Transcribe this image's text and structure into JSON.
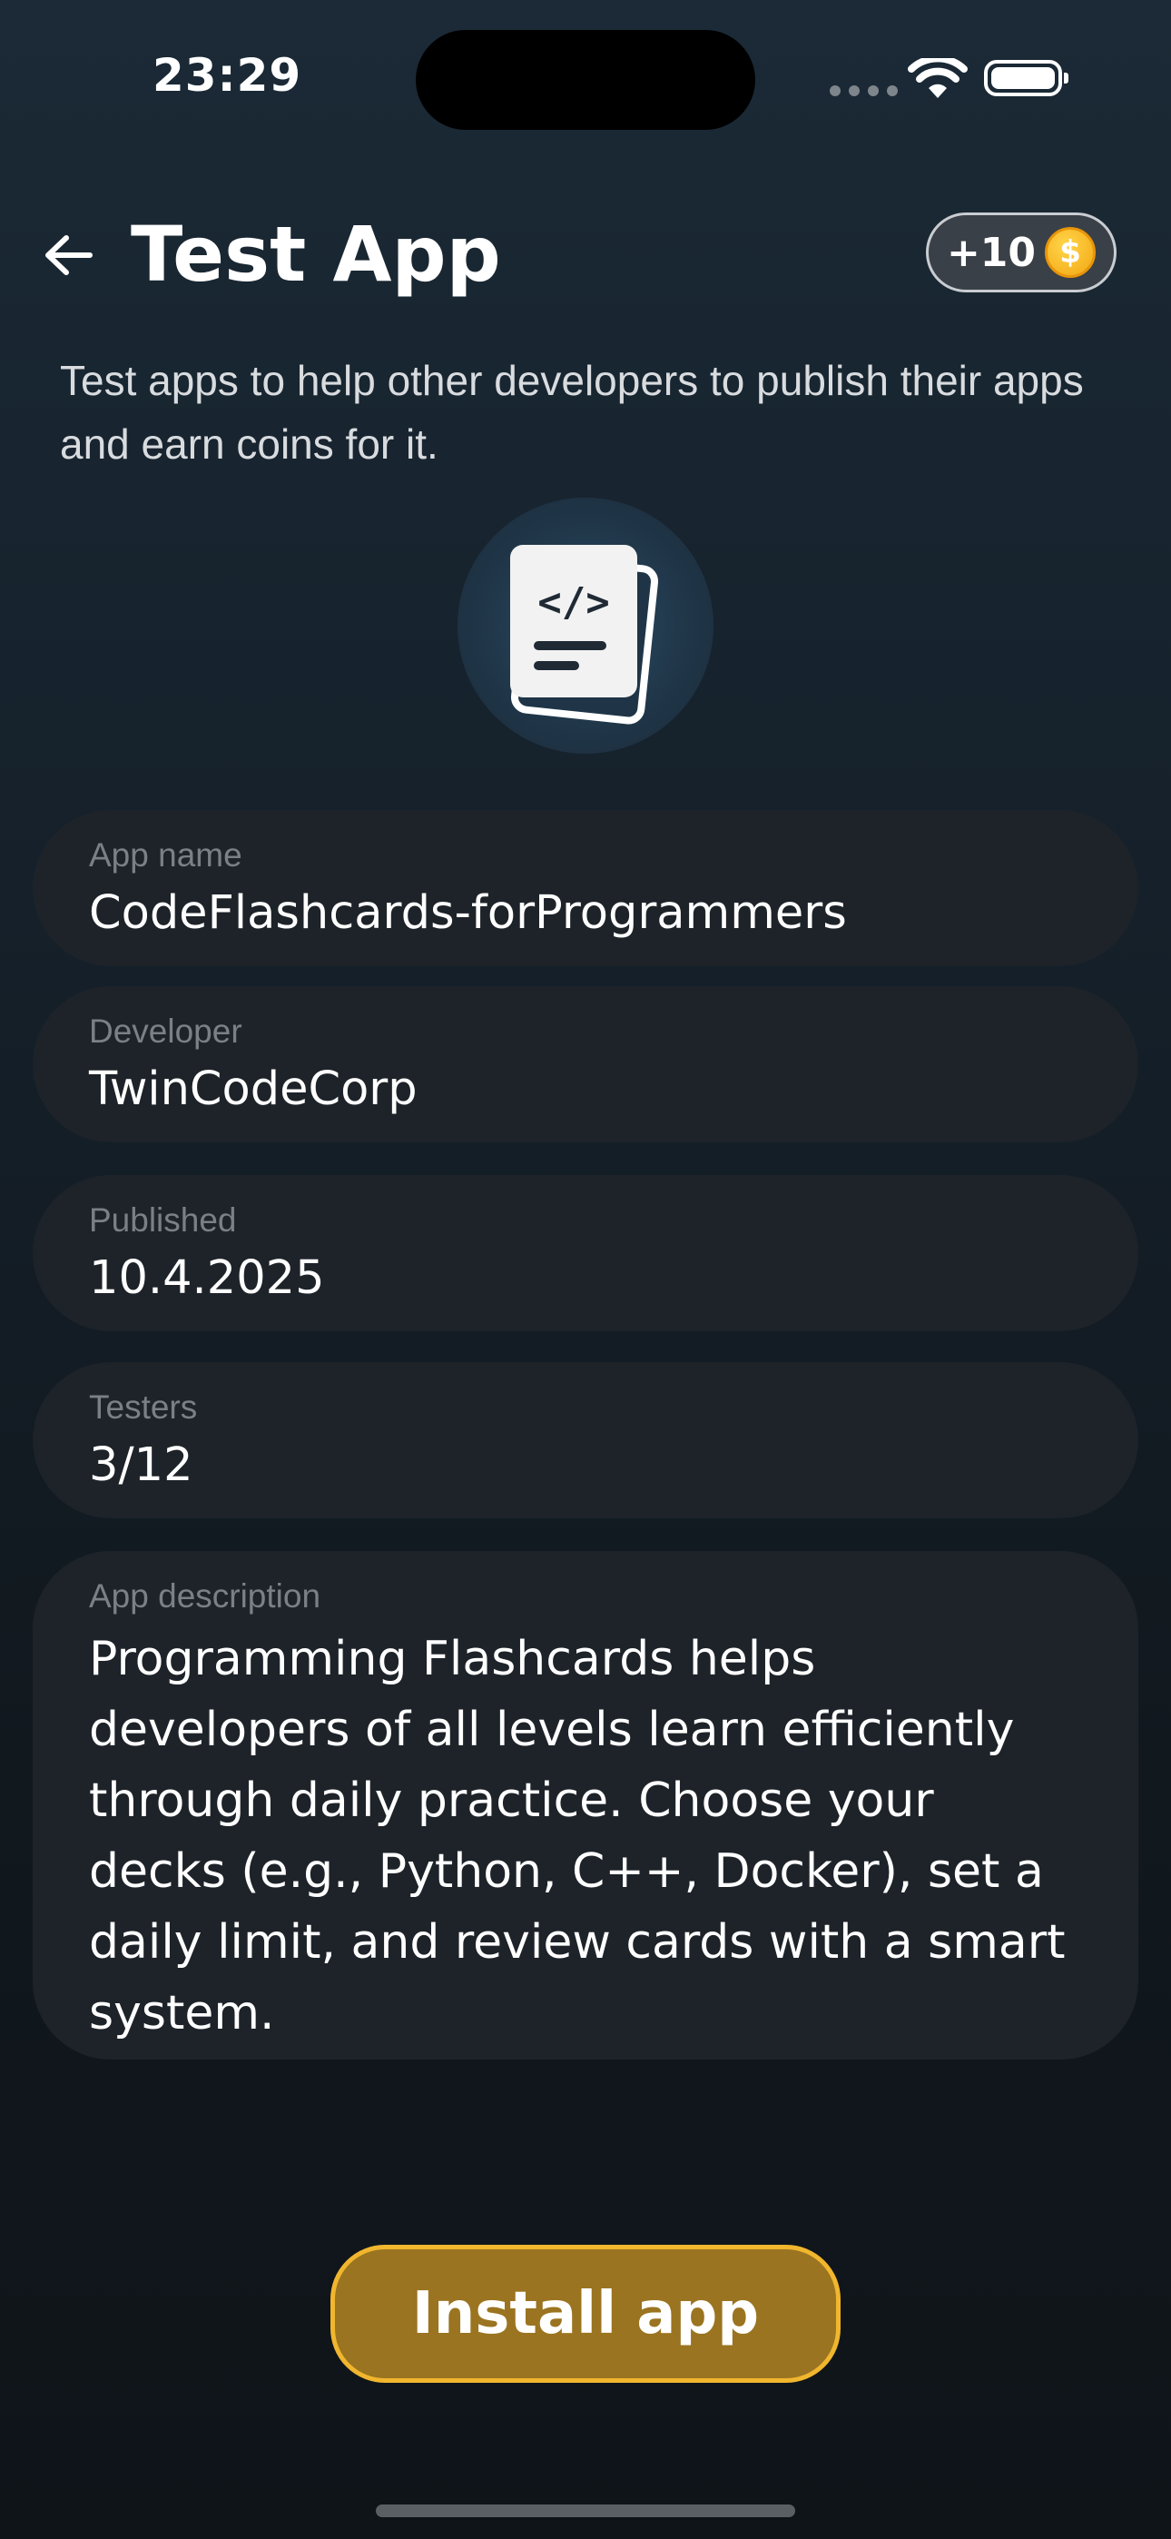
{
  "status_bar": {
    "time": "23:29"
  },
  "header": {
    "title": "Test App",
    "reward": "+10",
    "coin_symbol": "$"
  },
  "intro_text": "Test apps to help other developers to publish their apps and earn coins for it.",
  "app_icon": {
    "glyph": "</>",
    "icon_name": "code-card-icon"
  },
  "fields": [
    {
      "label": "App name",
      "value": "CodeFlashcards-forProgrammers"
    },
    {
      "label": "Developer",
      "value": "TwinCodeCorp"
    },
    {
      "label": "Published",
      "value": "10.4.2025"
    },
    {
      "label": "Testers",
      "value": "3/12"
    },
    {
      "label": "App description",
      "value": "Programming Flashcards helps developers of all levels learn efficiently through daily practice. Choose your decks (e.g., Python, C++, Docker), set a daily limit, and review cards with a smart system."
    }
  ],
  "install_button": {
    "label": "Install app"
  },
  "colors": {
    "accent": "#9a7420",
    "accent_border": "#f1b62e",
    "field_bg": "#1d2329",
    "coin": "#f3a712"
  }
}
